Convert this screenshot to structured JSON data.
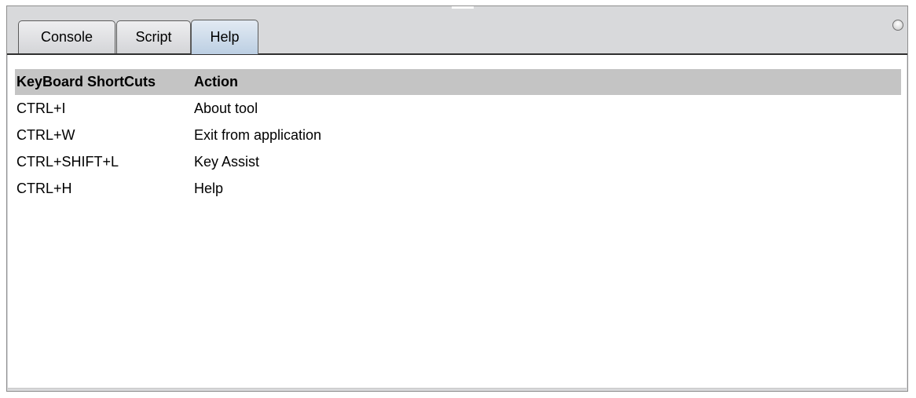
{
  "tabs": [
    {
      "label": "Console",
      "active": false
    },
    {
      "label": "Script",
      "active": false
    },
    {
      "label": "Help",
      "active": true
    }
  ],
  "table": {
    "headers": [
      "KeyBoard ShortCuts",
      "Action"
    ],
    "rows": [
      {
        "shortcut": "CTRL+I",
        "action": "About tool"
      },
      {
        "shortcut": "CTRL+W",
        "action": "Exit from application"
      },
      {
        "shortcut": "CTRL+SHIFT+L",
        "action": "Key Assist"
      },
      {
        "shortcut": "CTRL+H",
        "action": "Help"
      }
    ]
  },
  "colors": {
    "active_tab": "#bccfe3",
    "header_bg": "#c4c4c4",
    "frame_bg": "#d8d9db"
  }
}
